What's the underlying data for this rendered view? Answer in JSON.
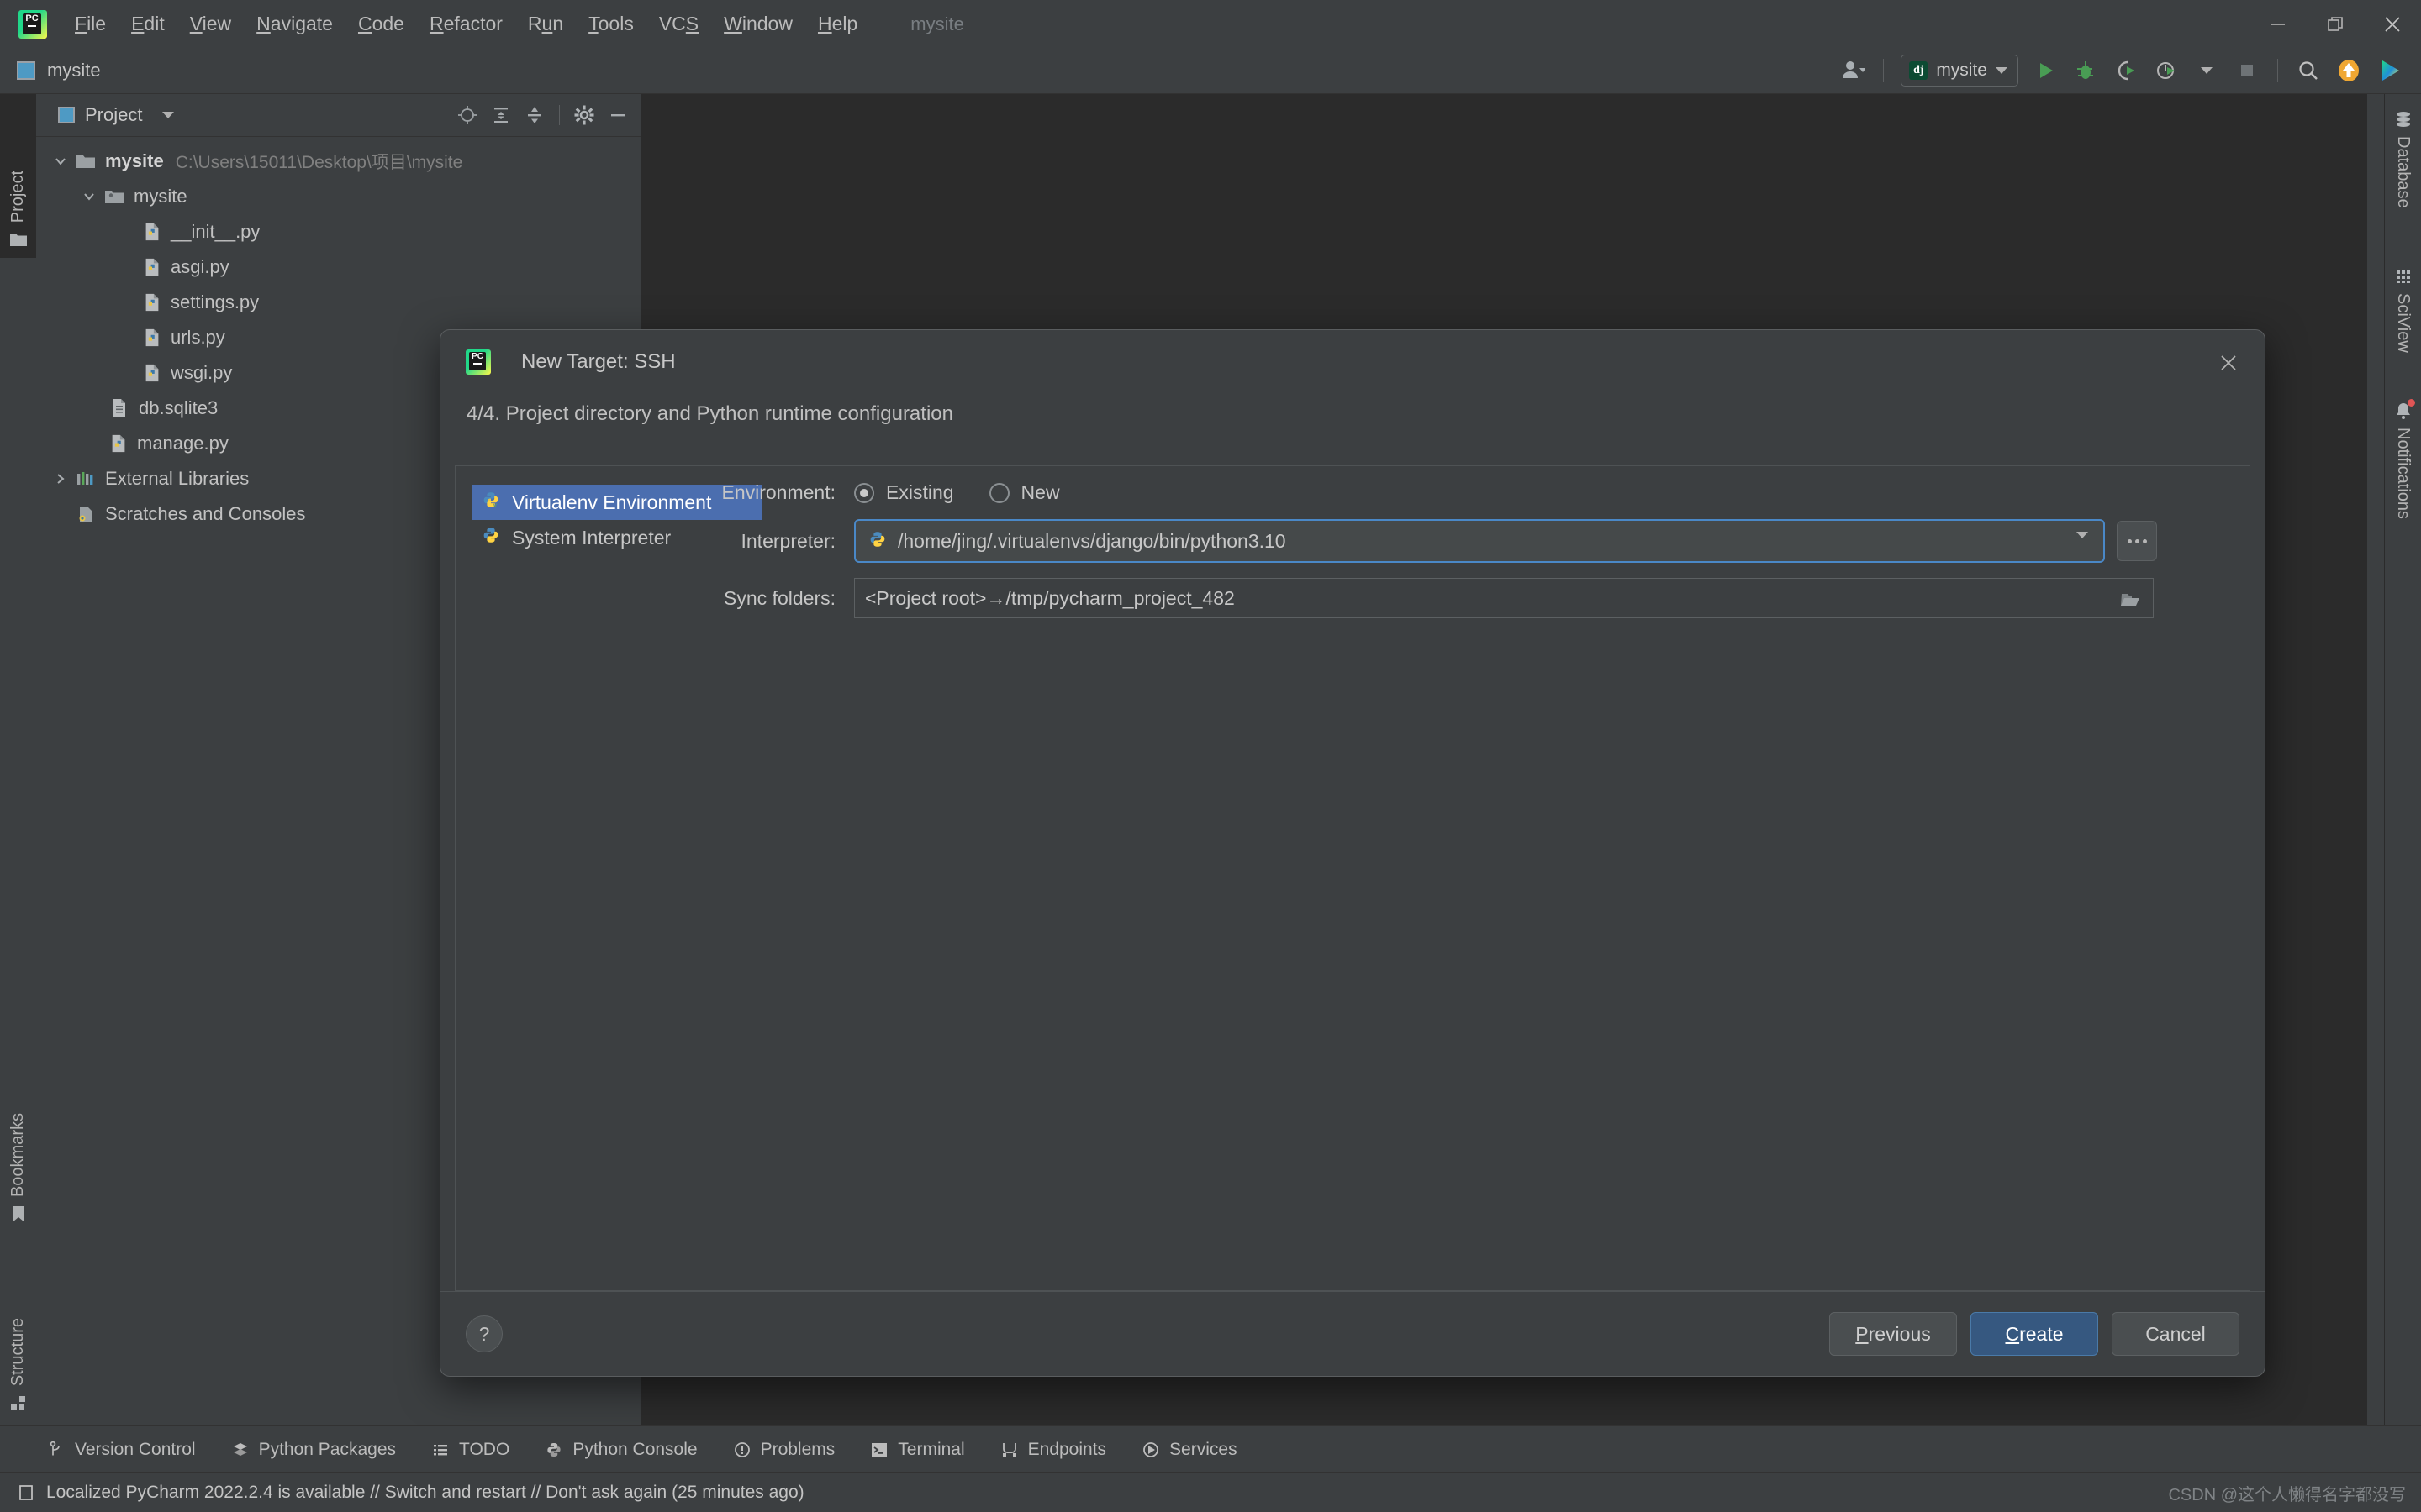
{
  "window": {
    "project_ghost_title": "mysite",
    "controls": [
      "minimize-icon",
      "restore-icon",
      "close-icon"
    ]
  },
  "menubar": {
    "logo": "pycharm-logo-icon",
    "items": [
      {
        "label": "File",
        "mnemonic": "F"
      },
      {
        "label": "Edit",
        "mnemonic": "E"
      },
      {
        "label": "View",
        "mnemonic": "V"
      },
      {
        "label": "Navigate",
        "mnemonic": "N"
      },
      {
        "label": "Code",
        "mnemonic": "C"
      },
      {
        "label": "Refactor",
        "mnemonic": "R"
      },
      {
        "label": "Run",
        "mnemonic": "u"
      },
      {
        "label": "Tools",
        "mnemonic": "T"
      },
      {
        "label": "VCS",
        "mnemonic": "S"
      },
      {
        "label": "Window",
        "mnemonic": "W"
      },
      {
        "label": "Help",
        "mnemonic": "H"
      }
    ]
  },
  "toolbar": {
    "project_label": "mysite",
    "run_config": {
      "name": "mysite",
      "badge": "dj",
      "icon": "django-icon"
    },
    "icons": [
      "user-account-icon",
      "run-icon",
      "debug-icon",
      "run-with-coverage-icon",
      "profile-icon",
      "stop-icon",
      "search-everywhere-icon",
      "update-project-icon",
      "dataspell-icon"
    ]
  },
  "left_rail": {
    "tabs": [
      {
        "label": "Project",
        "icon": "folder-icon",
        "active": true
      },
      {
        "label": "Bookmarks",
        "icon": "bookmark-icon",
        "active": false
      },
      {
        "label": "Structure",
        "icon": "structure-icon",
        "active": false
      }
    ]
  },
  "right_rail": {
    "tabs": [
      {
        "label": "Database",
        "icon": "database-icon",
        "badge": false
      },
      {
        "label": "SciView",
        "icon": "sciview-grid-icon",
        "badge": false
      },
      {
        "label": "Notifications",
        "icon": "bell-icon",
        "badge": true
      }
    ]
  },
  "project_panel": {
    "title": "Project",
    "tools": [
      "locate-icon",
      "expand-all-icon",
      "collapse-all-icon",
      "gear-icon",
      "hide-icon"
    ],
    "tree": [
      {
        "name": "mysite",
        "path": "C:\\Users\\15011\\Desktop\\项目\\mysite",
        "icon": "folder-root-icon",
        "twisty": "expanded",
        "indent": 0,
        "bold": true
      },
      {
        "name": "mysite",
        "path": "",
        "icon": "folder-source-icon",
        "twisty": "expanded",
        "indent": 1,
        "bold": false
      },
      {
        "name": "__init__.py",
        "path": "",
        "icon": "python-file-icon",
        "twisty": "none",
        "indent": 2,
        "bold": false
      },
      {
        "name": "asgi.py",
        "path": "",
        "icon": "python-file-icon",
        "twisty": "none",
        "indent": 2,
        "bold": false
      },
      {
        "name": "settings.py",
        "path": "",
        "icon": "python-file-icon",
        "twisty": "none",
        "indent": 2,
        "bold": false
      },
      {
        "name": "urls.py",
        "path": "",
        "icon": "python-file-icon",
        "twisty": "none",
        "indent": 2,
        "bold": false
      },
      {
        "name": "wsgi.py",
        "path": "",
        "icon": "python-file-icon",
        "twisty": "none",
        "indent": 2,
        "bold": false
      },
      {
        "name": "db.sqlite3",
        "path": "",
        "icon": "database-file-icon",
        "twisty": "none",
        "indent": 1,
        "bold": false
      },
      {
        "name": "manage.py",
        "path": "",
        "icon": "python-file-icon",
        "twisty": "none",
        "indent": 1,
        "bold": false
      },
      {
        "name": "External Libraries",
        "path": "",
        "icon": "libraries-icon",
        "twisty": "collapsed",
        "indent": 0,
        "bold": false
      },
      {
        "name": "Scratches and Consoles",
        "path": "",
        "icon": "scratches-icon",
        "twisty": "none",
        "indent": 0,
        "bold": false
      }
    ]
  },
  "dialog": {
    "title": "New Target: SSH",
    "title_icon": "pycharm-logo-icon",
    "close_icon": "close-icon",
    "subtitle": "4/4. Project directory and Python runtime configuration",
    "env_types": [
      {
        "label": "Virtualenv Environment",
        "icon": "virtualenv-icon",
        "selected": true
      },
      {
        "label": "System Interpreter",
        "icon": "python-icon",
        "selected": false
      }
    ],
    "environment": {
      "label": "Environment:",
      "options": [
        {
          "label": "Existing",
          "checked": true
        },
        {
          "label": "New",
          "checked": false
        }
      ]
    },
    "interpreter": {
      "label": "Interpreter:",
      "value": "/home/jing/.virtualenvs/django/bin/python3.10",
      "icon": "python-icon",
      "browse_button": "...",
      "dropdown_icon": "chevron-down-icon"
    },
    "sync_folders": {
      "label": "Sync folders:",
      "value": "<Project root>→/tmp/pycharm_project_482",
      "folder_icon": "folder-browse-icon"
    },
    "footer": {
      "help_label": "?",
      "previous": {
        "label": "Previous",
        "mnemonic": "P"
      },
      "create": {
        "label": "Create",
        "mnemonic": "C",
        "primary": true
      },
      "cancel": {
        "label": "Cancel",
        "mnemonic": ""
      }
    },
    "accent_color": "#4a88c7",
    "primary_button_color": "#365880",
    "selection_color": "#4b6eaf"
  },
  "bottom_tools": [
    {
      "label": "Version Control",
      "icon": "branch-icon"
    },
    {
      "label": "Python Packages",
      "icon": "packages-icon"
    },
    {
      "label": "TODO",
      "icon": "todo-icon"
    },
    {
      "label": "Python Console",
      "icon": "python-console-icon"
    },
    {
      "label": "Problems",
      "icon": "problems-icon"
    },
    {
      "label": "Terminal",
      "icon": "terminal-icon"
    },
    {
      "label": "Endpoints",
      "icon": "endpoints-icon"
    },
    {
      "label": "Services",
      "icon": "services-icon"
    }
  ],
  "statusbar": {
    "icon": "notification-icon",
    "message": "Localized PyCharm 2022.2.4 is available // Switch and restart // Don't ask again (25 minutes ago)",
    "watermark": "CSDN @这个人懒得名字都没写"
  }
}
